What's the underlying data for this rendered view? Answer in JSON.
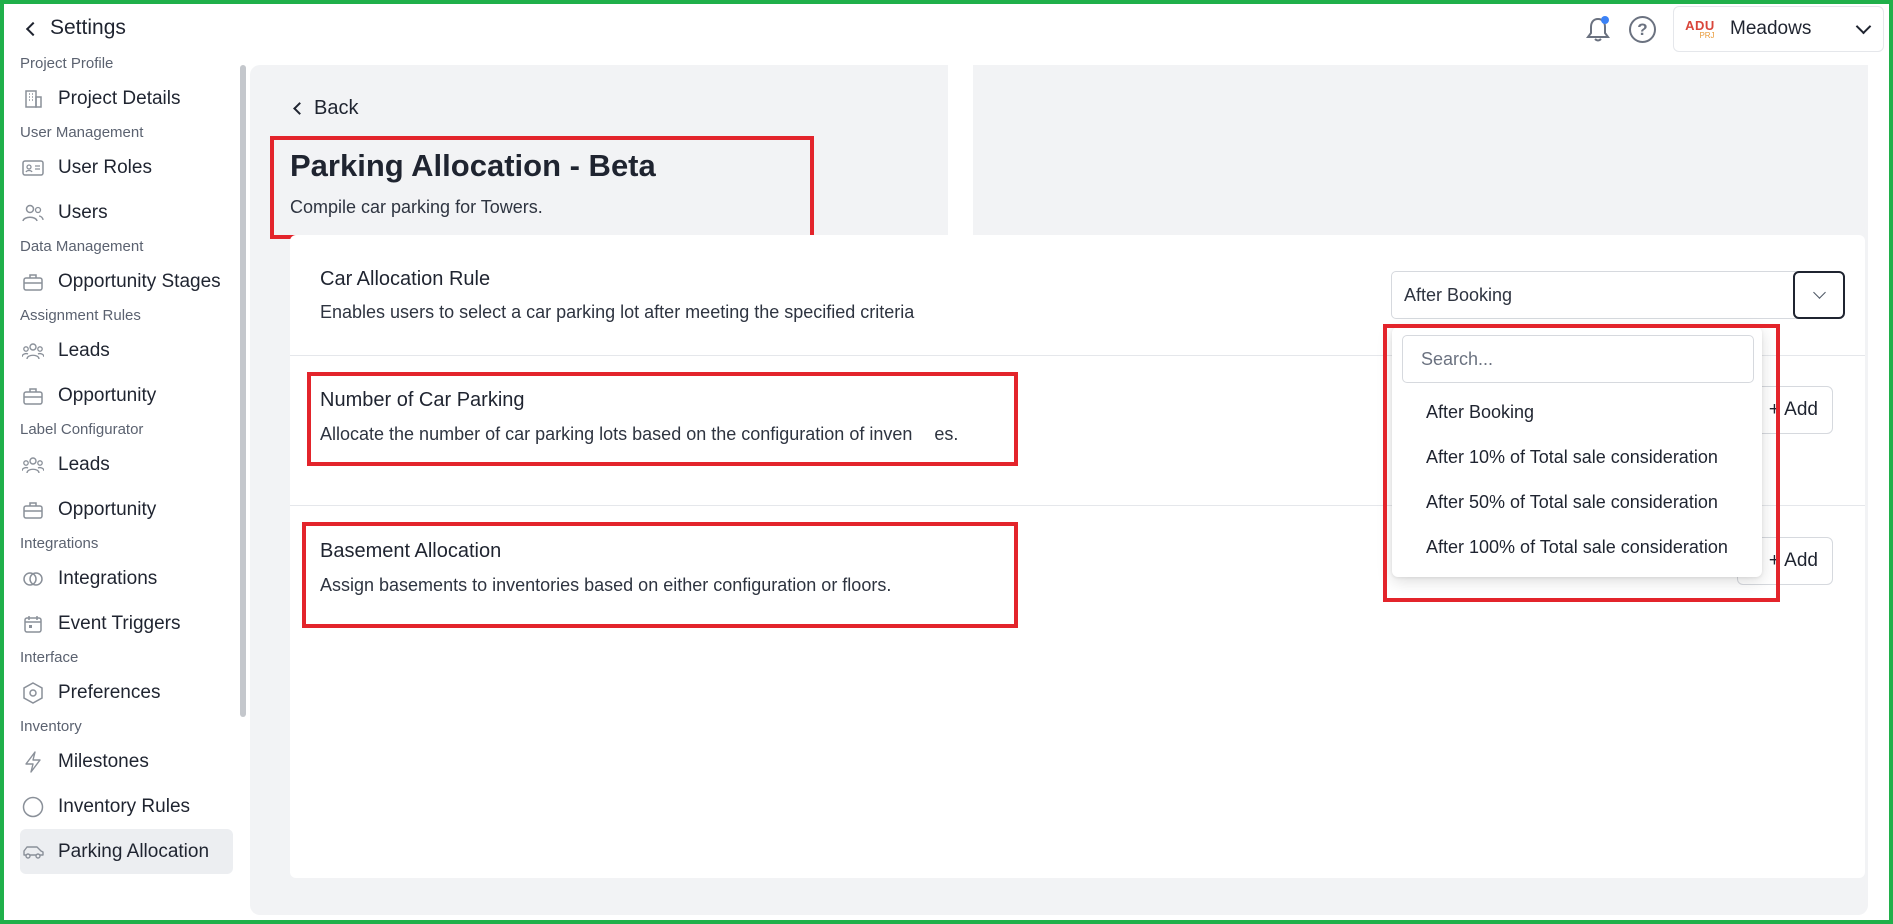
{
  "topbar": {
    "back_label": "Settings",
    "project_name": "Meadows",
    "logo_text": "ADU",
    "logo_subtext": "PRJ"
  },
  "sidebar": {
    "sections": [
      {
        "label": "Project Profile",
        "items": [
          {
            "label": "Project Details",
            "icon": "building-icon"
          }
        ]
      },
      {
        "label": "User Management",
        "items": [
          {
            "label": "User Roles",
            "icon": "id-card-icon"
          },
          {
            "label": "Users",
            "icon": "users-icon"
          }
        ]
      },
      {
        "label": "Data Management",
        "items": [
          {
            "label": "Opportunity Stages",
            "icon": "briefcase-icon"
          }
        ]
      },
      {
        "label": "Assignment Rules",
        "items": [
          {
            "label": "Leads",
            "icon": "group-icon"
          },
          {
            "label": "Opportunity",
            "icon": "briefcase-icon"
          }
        ]
      },
      {
        "label": "Label Configurator",
        "items": [
          {
            "label": "Leads",
            "icon": "group-icon"
          },
          {
            "label": "Opportunity",
            "icon": "briefcase-icon"
          }
        ]
      },
      {
        "label": "Integrations",
        "items": [
          {
            "label": "Integrations",
            "icon": "link-icon"
          },
          {
            "label": "Event Triggers",
            "icon": "calendar-icon"
          }
        ]
      },
      {
        "label": "Interface",
        "items": [
          {
            "label": "Preferences",
            "icon": "hexagon-icon"
          }
        ]
      },
      {
        "label": "Inventory",
        "items": [
          {
            "label": "Milestones",
            "icon": "bolt-icon"
          },
          {
            "label": "Inventory Rules",
            "icon": "circle-icon"
          },
          {
            "label": "Parking Allocation",
            "icon": "car-icon",
            "active": true
          }
        ]
      }
    ]
  },
  "main": {
    "back_label": "Back",
    "title": "Parking Allocation - Beta",
    "subtitle": "Compile car parking for Towers.",
    "rows": [
      {
        "title": "Car Allocation Rule",
        "description": "Enables users to select a car parking lot after meeting the specified criteria"
      },
      {
        "title": "Number of Car Parking",
        "description_left": "Allocate the number of car parking lots based on the configuration of inven",
        "description_right": "es.",
        "action": "+ Add"
      },
      {
        "title": "Basement Allocation",
        "description": "Assign basements to inventories based on either configuration or floors.",
        "action": "+ Add"
      }
    ],
    "rule_select": {
      "value": "After Booking",
      "search_placeholder": "Search...",
      "options": [
        "After Booking",
        "After 10% of Total sale consideration",
        "After 50% of Total sale consideration",
        "After 100% of Total sale consideration"
      ]
    }
  },
  "colors": {
    "highlight_red": "#e3242b",
    "frame_green": "#20b04a",
    "notification_dot": "#3b82f6"
  }
}
